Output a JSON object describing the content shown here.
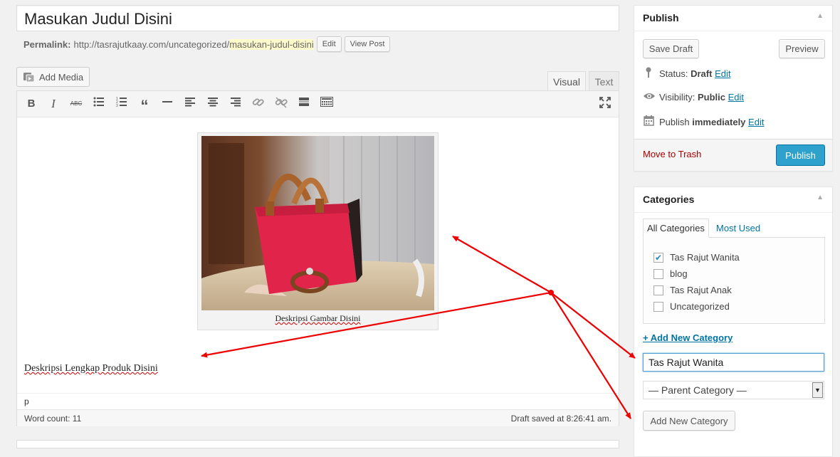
{
  "post": {
    "title": "Masukan Judul Disini",
    "permalink_label": "Permalink:",
    "permalink_base": "http://tasrajutkaay.com/uncategorized/",
    "permalink_slug": "masukan-judul-disini",
    "edit_label": "Edit",
    "view_post_label": "View Post"
  },
  "editor": {
    "add_media_label": "Add Media",
    "tabs": {
      "visual": "Visual",
      "text": "Text"
    },
    "toolbar": [
      {
        "name": "bold-icon",
        "glyph": "B"
      },
      {
        "name": "italic-icon",
        "glyph": "I"
      },
      {
        "name": "strikethrough-icon",
        "glyph": "ABC"
      },
      {
        "name": "bullet-list-icon",
        "glyph": "≔"
      },
      {
        "name": "numbered-list-icon",
        "glyph": "⒈"
      },
      {
        "name": "blockquote-icon",
        "glyph": "❝"
      },
      {
        "name": "horizontal-rule-icon",
        "glyph": "—"
      },
      {
        "name": "align-left-icon",
        "glyph": "≡"
      },
      {
        "name": "align-center-icon",
        "glyph": "≡"
      },
      {
        "name": "align-right-icon",
        "glyph": "≡"
      },
      {
        "name": "insert-link-icon",
        "glyph": "🔗"
      },
      {
        "name": "remove-link-icon",
        "glyph": "⛓"
      },
      {
        "name": "read-more-icon",
        "glyph": "▭"
      },
      {
        "name": "toolbar-toggle-icon",
        "glyph": "▦"
      }
    ],
    "fullscreen_icon": "fullscreen-icon",
    "image_caption": "Deskripsi Gambar Disini",
    "body_text": "Deskripsi Lengkap Produk Disini",
    "path": "p",
    "word_count": "Word count: 11",
    "draft_saved": "Draft saved at 8:26:41 am."
  },
  "publish_box": {
    "title": "Publish",
    "save_draft": "Save Draft",
    "preview": "Preview",
    "status_label": "Status:",
    "status_value": "Draft",
    "visibility_label": "Visibility:",
    "visibility_value": "Public",
    "publish_label": "Publish",
    "publish_value": "immediately",
    "edit": "Edit",
    "move_to_trash": "Move to Trash",
    "publish_button": "Publish"
  },
  "categories_box": {
    "title": "Categories",
    "tab_all": "All Categories",
    "tab_most_used": "Most Used",
    "items": [
      {
        "label": "Tas Rajut Wanita",
        "checked": true
      },
      {
        "label": "blog",
        "checked": false
      },
      {
        "label": "Tas Rajut Anak",
        "checked": false
      },
      {
        "label": "Uncategorized",
        "checked": false
      }
    ],
    "add_new_link": "+ Add New Category",
    "new_category_value": "Tas Rajut Wanita",
    "parent_category": "— Parent Category —",
    "add_new_button": "Add New Category"
  },
  "colors": {
    "link": "#0074a2",
    "primary_button": "#2ea2cc",
    "trash": "#aa0000",
    "annotation_arrow": "#ee0000",
    "bag": "#e0244a"
  }
}
